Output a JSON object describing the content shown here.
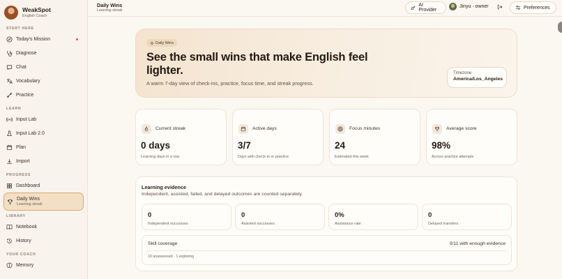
{
  "brand": {
    "name": "WeakSpot",
    "subtitle": "English Coach"
  },
  "sidebar": {
    "sections": [
      {
        "title": "START HERE",
        "items": [
          {
            "label": "Today's Mission",
            "icon": "compass-icon",
            "has_dot": true
          },
          {
            "label": "Diagnose",
            "icon": "stethoscope-icon"
          },
          {
            "label": "Chat",
            "icon": "chat-icon"
          },
          {
            "label": "Vocabulary",
            "icon": "translate-icon"
          },
          {
            "label": "Practice",
            "icon": "dumbbell-icon"
          }
        ]
      },
      {
        "title": "LEARN",
        "items": [
          {
            "label": "Input Lab",
            "icon": "radio-icon"
          },
          {
            "label": "Input Lab 2.0",
            "icon": "flask-icon"
          },
          {
            "label": "Plan",
            "icon": "calendar-icon"
          },
          {
            "label": "Import",
            "icon": "import-icon"
          }
        ]
      },
      {
        "title": "PROGRESS",
        "items": [
          {
            "label": "Dashboard",
            "icon": "grid-icon"
          },
          {
            "label": "Daily Wins",
            "sub": "Learning streak",
            "icon": "trophy-icon",
            "active": true
          }
        ]
      },
      {
        "title": "LIBRARY",
        "items": [
          {
            "label": "Notebook",
            "icon": "book-icon"
          },
          {
            "label": "History",
            "icon": "history-icon"
          }
        ]
      },
      {
        "title": "YOUR COACH",
        "items": [
          {
            "label": "Memory",
            "icon": "brain-icon"
          }
        ]
      }
    ]
  },
  "header": {
    "title": "Daily Wins",
    "subtitle": "Learning streak",
    "ai_provider_label": "AI Provider",
    "user_label": "Jinyu · owner",
    "preferences_label": "Preferences"
  },
  "hero": {
    "badge": "Daily Wins",
    "title": "See the small wins that make English feel lighter.",
    "description": "A warm 7-day view of check-ins, practice, focus time, and streak progress.",
    "timezone_label": "Timezone",
    "timezone_value": "America/Los_Angeles"
  },
  "stats": [
    {
      "label": "Current streak",
      "value": "0 days",
      "note": "Learning days in a row",
      "icon": "flame-icon"
    },
    {
      "label": "Active days",
      "value": "3/7",
      "note": "Days with check-in or practice",
      "icon": "calendar-icon"
    },
    {
      "label": "Focus minutes",
      "value": "24",
      "note": "Estimated this week",
      "icon": "target-icon"
    },
    {
      "label": "Average score",
      "value": "98%",
      "note": "Across practice attempts",
      "icon": "trophy-icon"
    }
  ],
  "evidence": {
    "title": "Learning evidence",
    "description": "Independent, assisted, failed, and delayed outcomes are counted separately.",
    "cards": [
      {
        "value": "0",
        "label": "Independent successes"
      },
      {
        "value": "0",
        "label": "Assisted successes"
      },
      {
        "value": "0%",
        "label": "Assistance rate"
      },
      {
        "value": "0",
        "label": "Delayed transfers"
      }
    ],
    "skill_title": "Skill coverage",
    "skill_summary": "0/11 with enough evidence",
    "skill_note": "10 unassessed · 1 exploring"
  },
  "colors": {
    "accent": "#d9a974",
    "active_bg": "#f3dfc4",
    "alert_dot": "#d9534f",
    "background": "#fbf7f1"
  }
}
